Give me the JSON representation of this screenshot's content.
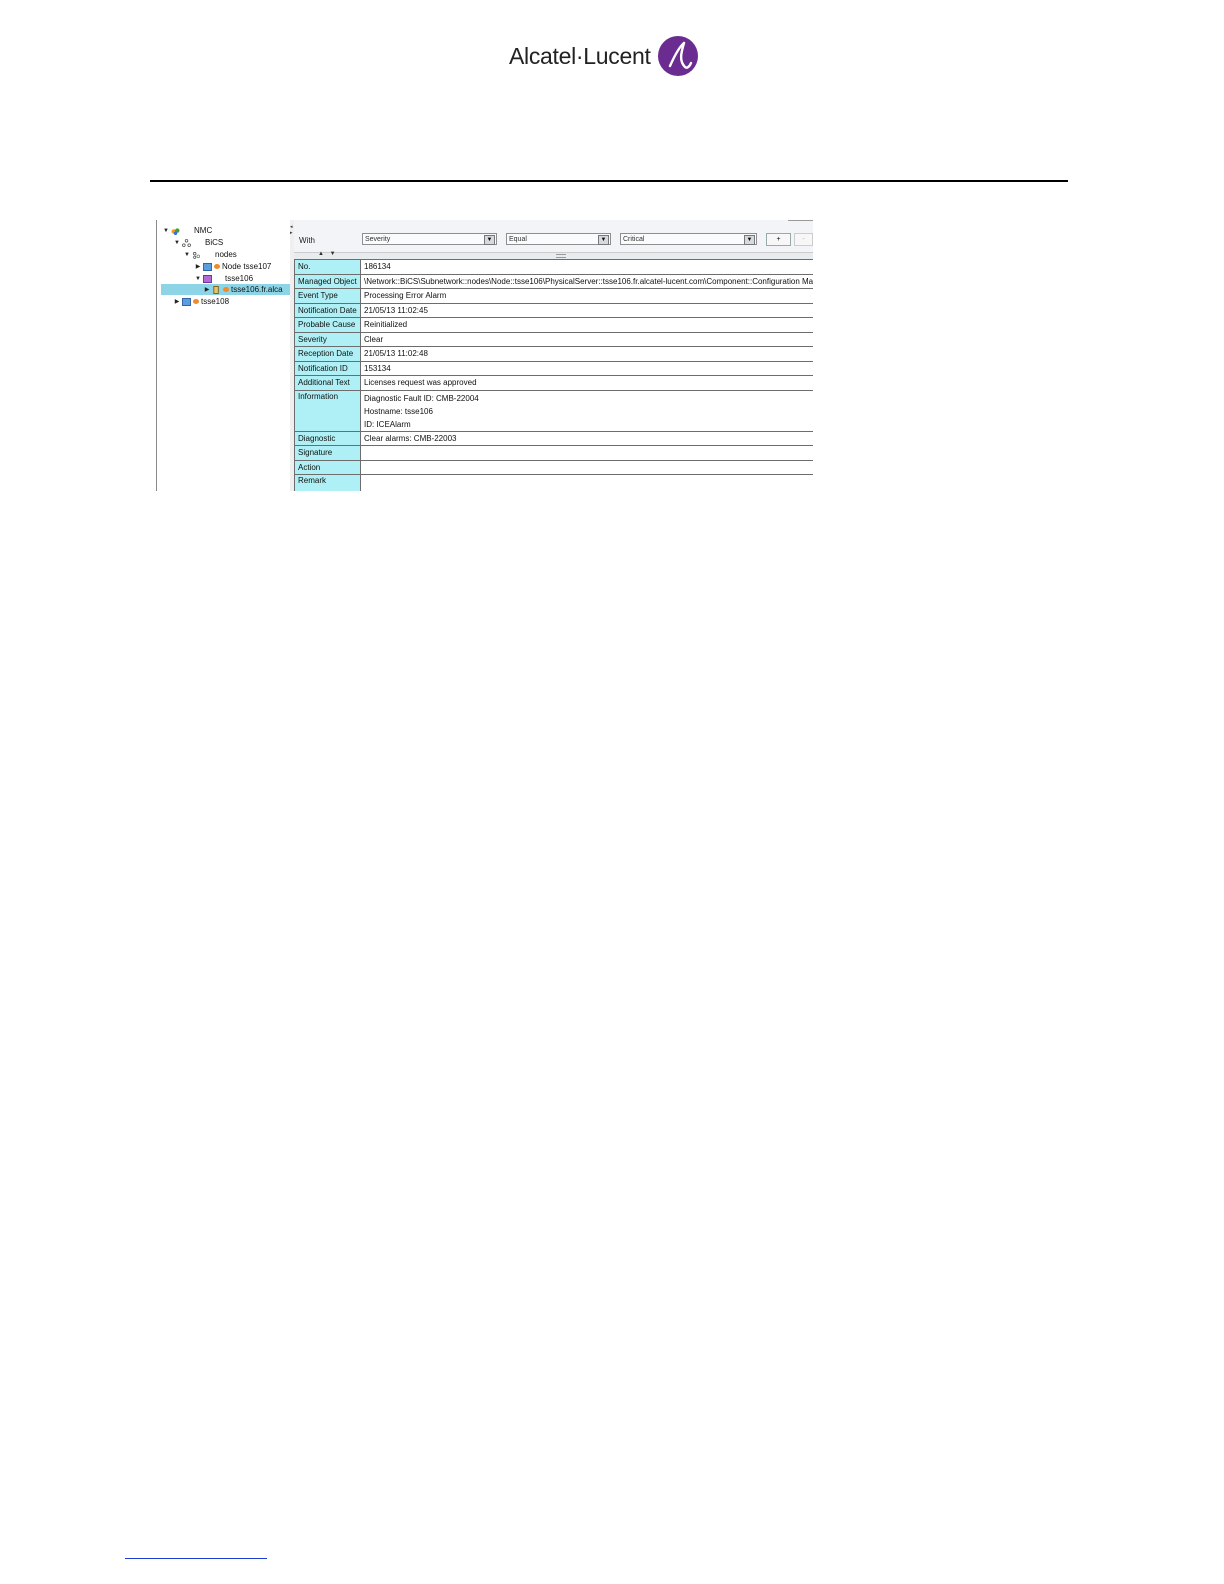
{
  "header": {
    "logo_text": "Alcatel·Lucent"
  },
  "tree": {
    "items": [
      {
        "label": "NMC",
        "toggle": "▼"
      },
      {
        "label": "BiCS",
        "toggle": "▼"
      },
      {
        "label": "nodes",
        "toggle": "▼"
      },
      {
        "label": "Node tsse107",
        "toggle": "▶"
      },
      {
        "label": "tsse106",
        "toggle": "▼"
      },
      {
        "label": "tsse106.fr.alca",
        "toggle": "▶"
      },
      {
        "label": "tsse108",
        "toggle": "▶"
      }
    ]
  },
  "filter": {
    "with_label": "With",
    "field_value": "Severity",
    "operator_value": "Equal",
    "criteria_value": "Critical",
    "add_label": "+",
    "remove_label": "-",
    "splitter_arrows": "▲ ▼"
  },
  "properties": {
    "no": {
      "label": "No.",
      "value": "186134"
    },
    "managed_object": {
      "label": "Managed Object",
      "value": "\\Network::BiCS\\Subnetwork::nodes\\Node::tsse106\\PhysicalServer::tsse106.fr.alcatel-lucent.com\\Component::Configuration Ma"
    },
    "event_type": {
      "label": "Event Type",
      "value": "Processing Error Alarm"
    },
    "notification_date": {
      "label": "Notification Date",
      "value": "21/05/13 11:02:45"
    },
    "probable_cause": {
      "label": "Probable Cause",
      "value": "Reinitialized"
    },
    "severity": {
      "label": "Severity",
      "value": "Clear"
    },
    "reception_date": {
      "label": "Reception Date",
      "value": "21/05/13 11:02:48"
    },
    "notification_id": {
      "label": "Notification ID",
      "value": "153134"
    },
    "additional_text": {
      "label": "Additional Text",
      "value": "Licenses request was approved"
    },
    "information": {
      "label": "Information",
      "lines": [
        "Diagnostic Fault ID: CMB-22004",
        "Hostname: tsse106",
        "ID: ICEAlarm"
      ]
    },
    "diagnostic": {
      "label": "Diagnostic",
      "value": " Clear alarms: CMB-22003"
    },
    "signature": {
      "label": "Signature",
      "value": ""
    },
    "action": {
      "label": "Action",
      "value": ""
    },
    "remark": {
      "label": "Remark",
      "value": ""
    }
  },
  "colors": {
    "key_cell": "#aef0f5",
    "selection": "#8dd4e6",
    "logo_purple": "#6a2c91",
    "status_dot": "#f08a2a"
  }
}
